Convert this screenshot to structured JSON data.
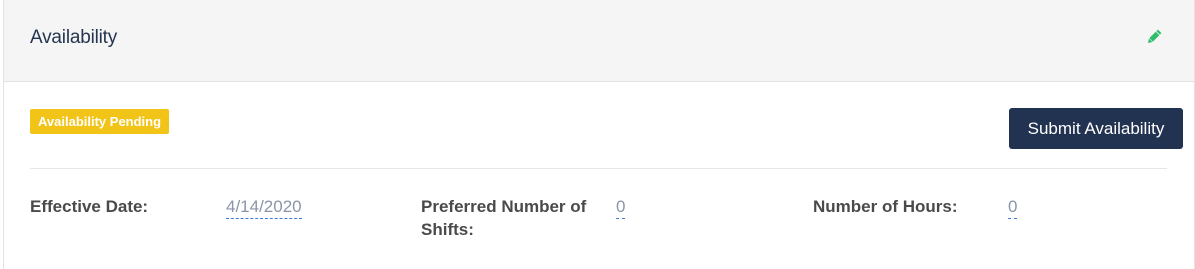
{
  "panel": {
    "title": "Availability",
    "edit_icon": "pencil-icon",
    "status_badge": "Availability Pending",
    "submit_label": "Submit Availability"
  },
  "fields": [
    {
      "label": "Effective Date:",
      "value": "4/14/2020"
    },
    {
      "label": "Preferred Number of Shifts:",
      "value": "0"
    },
    {
      "label": "Number of Hours:",
      "value": "0"
    }
  ],
  "colors": {
    "header_bg": "#f5f5f5",
    "title_text": "#26354f",
    "edit_icon": "#2ebd6b",
    "badge_bg": "#f2c418",
    "button_bg": "#223352",
    "link_underline": "#3f79d6"
  }
}
